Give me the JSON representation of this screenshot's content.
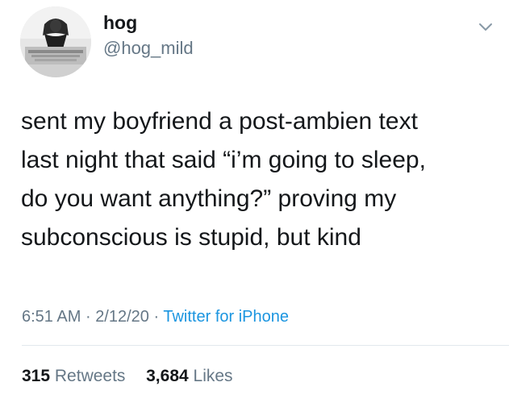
{
  "author": {
    "name": "hog",
    "handle": "@hog_mild"
  },
  "icons": {
    "menu": "chevron-down-icon",
    "avatar": "profile-photo"
  },
  "tweet": {
    "text": "sent my boyfriend a post-ambien text\nlast night that said “i’m going to sleep,\ndo you want anything?” proving my\nsubconscious is stupid, but kind",
    "time": "6:51 AM",
    "separator": "·",
    "date": "2/12/20",
    "source": "Twitter for iPhone"
  },
  "stats": {
    "retweets_count": "315",
    "retweets_label": "Retweets",
    "likes_count": "3,684",
    "likes_label": "Likes"
  },
  "colors": {
    "text": "#14171a",
    "secondary": "#657786",
    "link": "#1b95e0",
    "divider": "#e1e8ed"
  }
}
